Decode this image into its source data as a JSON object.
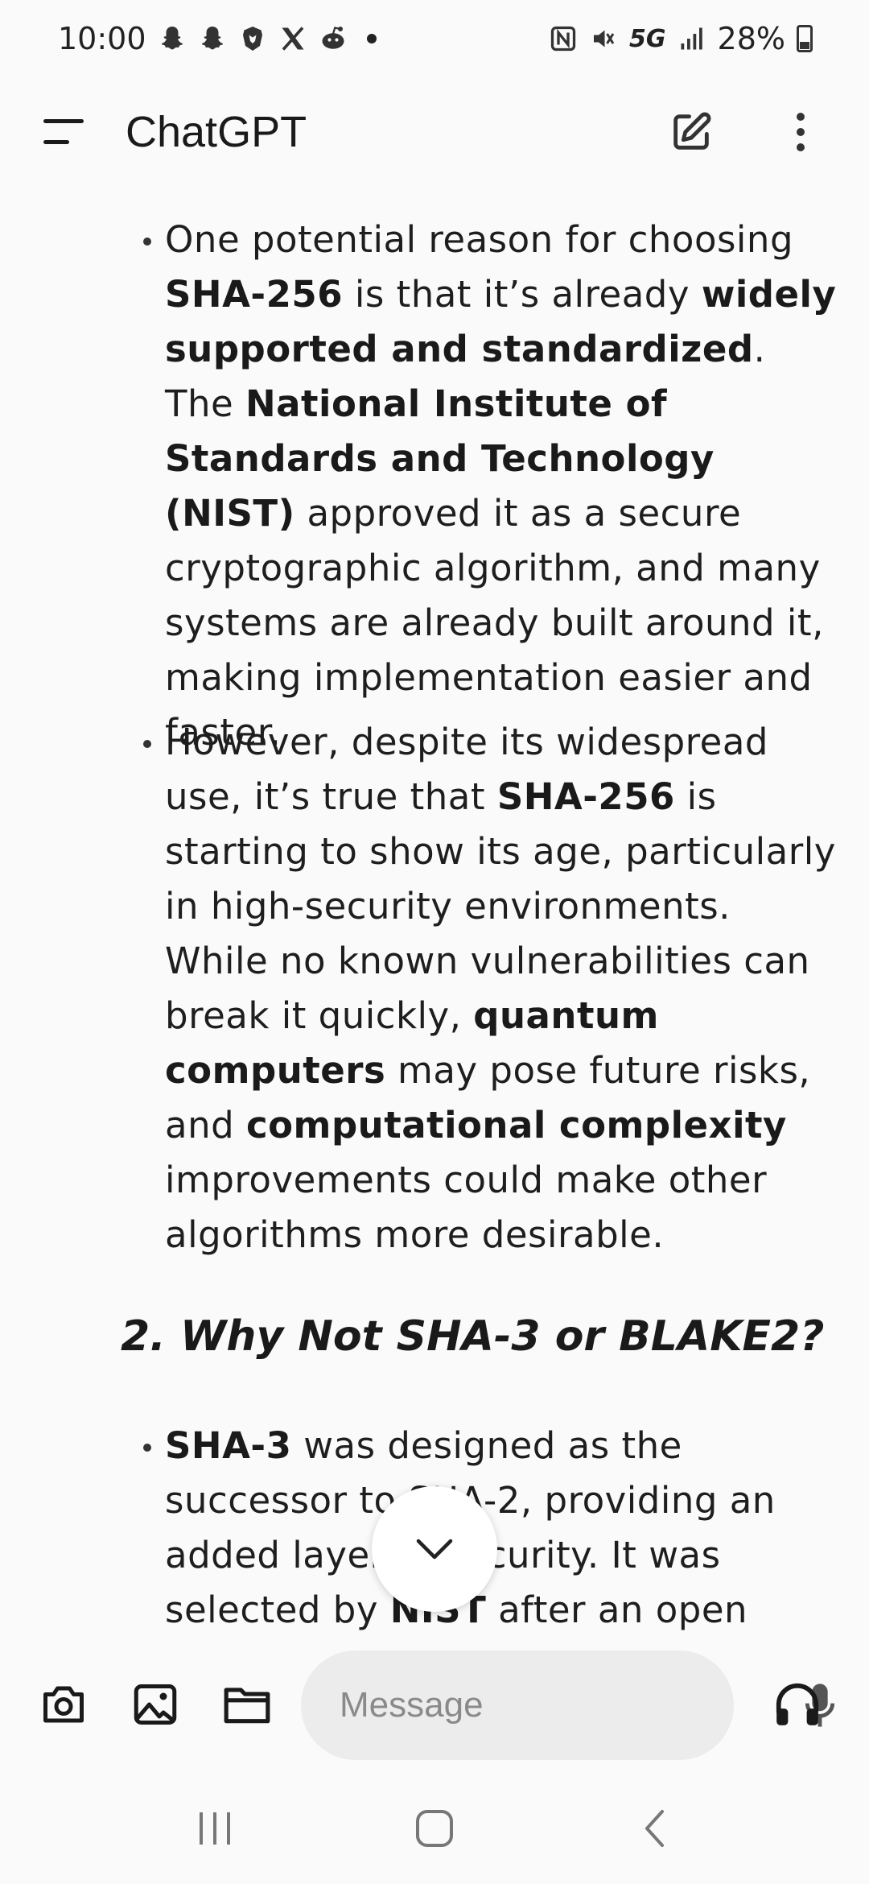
{
  "status_bar": {
    "time": "10:00",
    "network": "5G",
    "battery": "28%"
  },
  "app_bar": {
    "title": "ChatGPT"
  },
  "content": {
    "bullet1": [
      {
        "t": "One potential reason for choosing ",
        "b": false
      },
      {
        "t": "SHA-256",
        "b": true
      },
      {
        "t": " is that it’s already ",
        "b": false
      },
      {
        "t": "widely supported and standardized",
        "b": true
      },
      {
        "t": ". The ",
        "b": false
      },
      {
        "t": "National Institute of Standards and Technology (NIST)",
        "b": true
      },
      {
        "t": " approved it as a secure cryptographic algorithm, and many systems are already built around it, making implementation easier and faster.",
        "b": false
      }
    ],
    "bullet2": [
      {
        "t": "However, despite its widespread use, it’s true that ",
        "b": false
      },
      {
        "t": "SHA-256",
        "b": true
      },
      {
        "t": " is starting to show its age, particularly in high-security environments. While no known vulnerabilities can break it quickly, ",
        "b": false
      },
      {
        "t": "quantum computers",
        "b": true
      },
      {
        "t": " may pose future risks, and ",
        "b": false
      },
      {
        "t": "computational complexity",
        "b": true
      },
      {
        "t": " improvements could make other algorithms more desirable.",
        "b": false
      }
    ],
    "heading": "2. Why Not SHA-3 or BLAKE2?",
    "bullet3": [
      {
        "t": "SHA-3",
        "b": true
      },
      {
        "t": " was designed as the successor to SHA-2, providing an added layer of security. It was selected by ",
        "b": false
      },
      {
        "t": "NIST",
        "b": true
      },
      {
        "t": " after an open",
        "b": false
      }
    ]
  },
  "composer": {
    "placeholder": "Message"
  },
  "icons": {
    "menu": "menu-icon",
    "new_chat": "edit-icon",
    "more": "more-vertical-icon",
    "camera": "camera-icon",
    "image": "image-icon",
    "folder": "folder-icon",
    "mic": "mic-icon",
    "headphones": "headphones-icon",
    "scroll_down": "chevron-down-icon"
  }
}
